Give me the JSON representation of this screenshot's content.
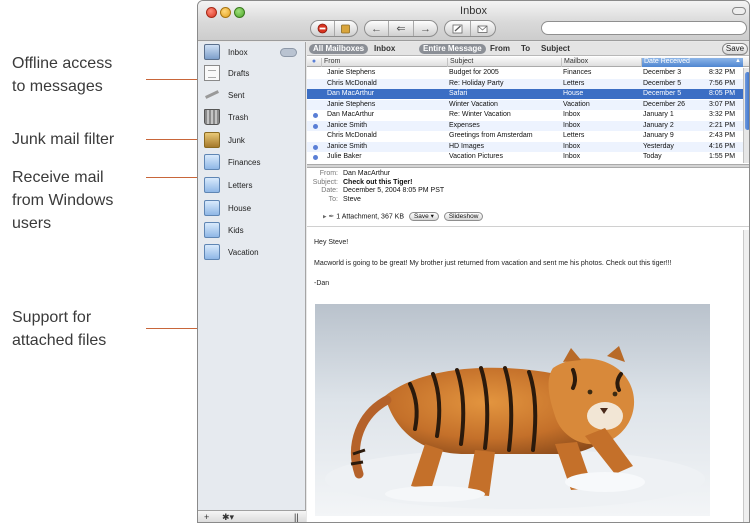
{
  "callouts": [
    {
      "lines": [
        "Offline access",
        "to messages"
      ]
    },
    {
      "lines": [
        "Junk mail filter"
      ]
    },
    {
      "lines": [
        "Receive mail",
        "from Windows",
        "users"
      ]
    },
    {
      "lines": [
        "Support for",
        "attached files"
      ]
    }
  ],
  "window": {
    "title": "Inbox",
    "accent": "#3b6ec4"
  },
  "toolbar": {
    "delete_icon": "delete-icon",
    "junk_icon": "junk-icon",
    "reply_icon": "reply-icon",
    "reply_all_icon": "reply-all-icon",
    "forward_icon": "forward-icon",
    "compose_icon": "compose-icon",
    "get_mail_icon": "get-mail-icon",
    "search_placeholder": ""
  },
  "sidebar": {
    "items": [
      {
        "label": "Inbox",
        "icon": "inbox-icon"
      },
      {
        "label": "Drafts",
        "icon": "drafts-icon"
      },
      {
        "label": "Sent",
        "icon": "sent-icon"
      },
      {
        "label": "Trash",
        "icon": "trash-icon"
      },
      {
        "label": "Junk",
        "icon": "junk-icon"
      },
      {
        "label": "Finances",
        "icon": "folder-icon"
      },
      {
        "label": "Letters",
        "icon": "folder-icon"
      },
      {
        "label": "House",
        "icon": "folder-icon"
      },
      {
        "label": "Kids",
        "icon": "folder-icon"
      },
      {
        "label": "Vacation",
        "icon": "folder-icon"
      }
    ],
    "footer": {
      "add": "+",
      "action": "✱▾",
      "resize": "||"
    }
  },
  "filter": {
    "all_mailboxes": "All Mailboxes",
    "inbox": "Inbox",
    "entire_message": "Entire Message",
    "from": "From",
    "to": "To",
    "subject": "Subject",
    "save": "Save"
  },
  "columns": {
    "dot": "●",
    "from": "From",
    "subject": "Subject",
    "mailbox": "Mailbox",
    "date_received": "Date Received",
    "sort_arrow": "▲"
  },
  "messages": [
    {
      "unread": false,
      "from": "Janie Stephens",
      "subject": "Budget for 2005",
      "mailbox": "Finances",
      "date": "December 3",
      "time": "8:32 PM"
    },
    {
      "unread": false,
      "from": "Chris McDonald",
      "subject": "Re: Holiday Party",
      "mailbox": "Letters",
      "date": "December 5",
      "time": "7:56 PM"
    },
    {
      "unread": false,
      "from": "Dan MacArthur",
      "subject": "Safari",
      "mailbox": "House",
      "date": "December 5",
      "time": "8:05 PM"
    },
    {
      "unread": false,
      "from": "Janie Stephens",
      "subject": "Winter Vacation",
      "mailbox": "Vacation",
      "date": "December 26",
      "time": "3:07 PM"
    },
    {
      "unread": true,
      "from": "Dan MacArthur",
      "subject": "Re: Winter Vacation",
      "mailbox": "Inbox",
      "date": "January 1",
      "time": "3:32 PM"
    },
    {
      "unread": true,
      "from": "Janice Smith",
      "subject": "Expenses",
      "mailbox": "Inbox",
      "date": "January 2",
      "time": "2:21 PM"
    },
    {
      "unread": false,
      "from": "Chris McDonald",
      "subject": "Greetings from Amsterdam",
      "mailbox": "Letters",
      "date": "January 9",
      "time": "2:43 PM"
    },
    {
      "unread": true,
      "from": "Janice Smith",
      "subject": "HD Images",
      "mailbox": "Inbox",
      "date": "Yesterday",
      "time": "4:16 PM"
    },
    {
      "unread": true,
      "from": "Julie Baker",
      "subject": "Vacation Pictures",
      "mailbox": "Inbox",
      "date": "Today",
      "time": "1:55 PM"
    }
  ],
  "selected_index": 2,
  "message": {
    "from_label": "From:",
    "from": "Dan MacArthur",
    "subject_label": "Subject:",
    "subject": "Check out this Tiger!",
    "date_label": "Date:",
    "date": "December 5, 2004 8:05 PM PST",
    "to_label": "To:",
    "to": "Steve",
    "attachment_summary": "1 Attachment, 367 KB",
    "save_label": "Save ▾",
    "slideshow_label": "Slideshow",
    "greeting": "Hey Steve!",
    "body": "Macworld is going to be great! My brother just returned from vacation and sent me his photos. Check out this tiger!!!",
    "signature": "-Dan"
  }
}
